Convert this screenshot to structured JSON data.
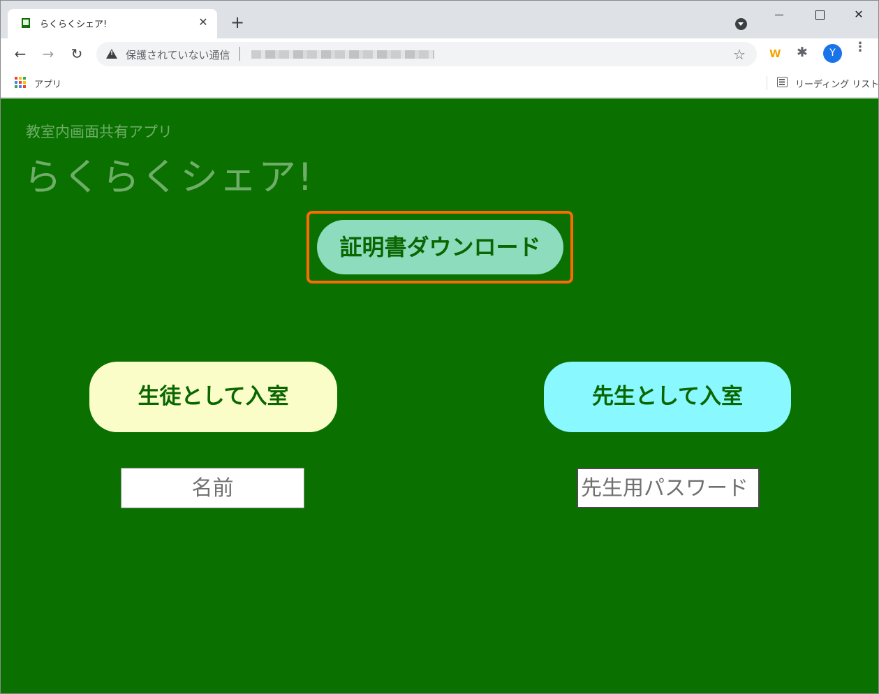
{
  "browser": {
    "tab_title": "らくらくシェア!",
    "tab_close": "✕",
    "new_tab": "+",
    "nav_back": "←",
    "nav_forward": "→",
    "reload": "↻",
    "security_text": "保護されていない通信",
    "star": "☆",
    "ext_w": "W",
    "ext_puzzle": "✱",
    "avatar_letter": "Y",
    "menu": "⋮",
    "bookmarks": {
      "apps_label": "アプリ",
      "reading_list_label": "リーディング リスト"
    }
  },
  "page": {
    "subtitle": "教室内画面共有アプリ",
    "title": "らくらくシェア!",
    "cert_button": "証明書ダウンロード",
    "student_button": "生徒として入室",
    "teacher_button": "先生として入室",
    "name_placeholder": "名前",
    "password_placeholder": "先生用パスワード"
  },
  "colors": {
    "page_background": "#0a7000",
    "cert_button_bg": "#8ddcbe",
    "student_button_bg": "#fafdc8",
    "teacher_button_bg": "#89f8ff",
    "button_text": "#0a6600",
    "highlight_border": "#ff6a00"
  },
  "apps_icon_colors": [
    "#ea4335",
    "#fbbc04",
    "#34a853",
    "#4285f4",
    "#ea4335",
    "#fbbc04",
    "#34a853",
    "#4285f4",
    "#ea4335"
  ]
}
